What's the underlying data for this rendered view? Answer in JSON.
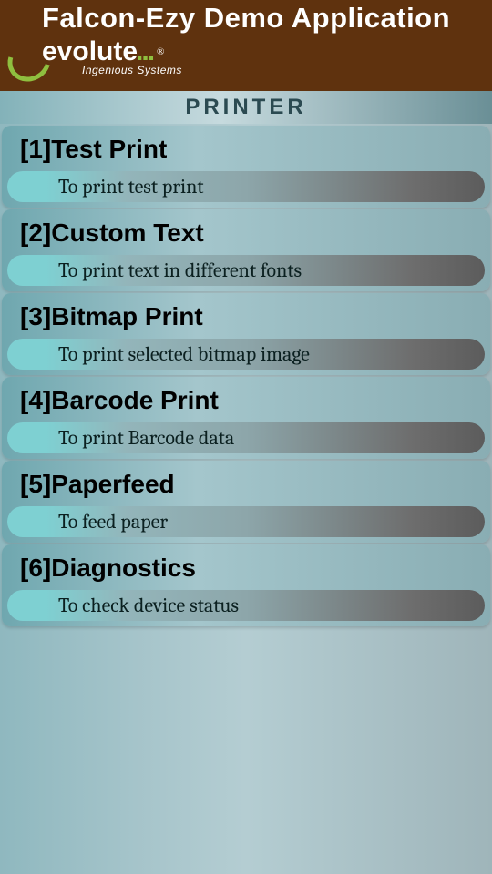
{
  "header": {
    "title": "Falcon-Ezy Demo Application",
    "brand_text": "evolute",
    "brand_dots": "...",
    "brand_reg": "®",
    "brand_sub": "Ingenious Systems"
  },
  "section": {
    "title": "PRINTER"
  },
  "menu": {
    "items": [
      {
        "title": "[1]Test Print",
        "desc": "To print test print"
      },
      {
        "title": "[2]Custom Text",
        "desc": "To print text in different fonts"
      },
      {
        "title": "[3]Bitmap Print",
        "desc": "To print selected bitmap image"
      },
      {
        "title": "[4]Barcode Print",
        "desc": "To print Barcode data"
      },
      {
        "title": "[5]Paperfeed",
        "desc": "To feed paper"
      },
      {
        "title": "[6]Diagnostics",
        "desc": "To check device status"
      }
    ]
  }
}
